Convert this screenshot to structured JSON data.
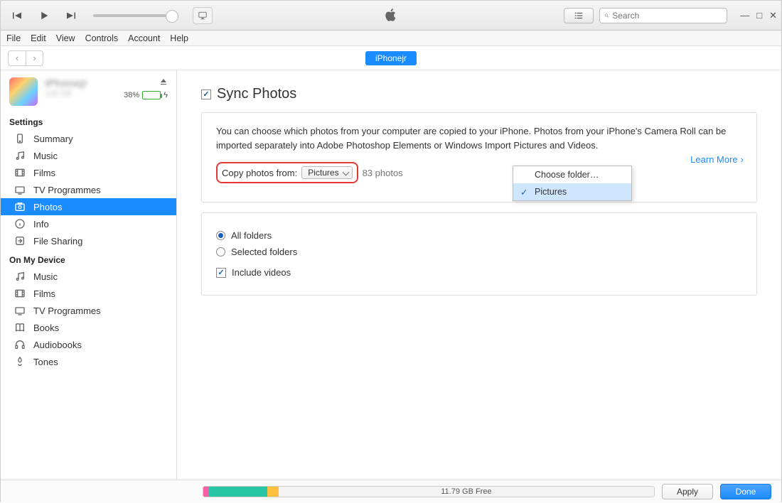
{
  "menubar": [
    "File",
    "Edit",
    "View",
    "Controls",
    "Account",
    "Help"
  ],
  "search_placeholder": "Search",
  "nav": {
    "device_pill": "iPhonejr"
  },
  "device": {
    "name": "iPhonejr",
    "subtitle": "128 GB",
    "battery_pct": "38%"
  },
  "sidebar": {
    "settings_title": "Settings",
    "settings": [
      {
        "icon": "summary",
        "label": "Summary"
      },
      {
        "icon": "music",
        "label": "Music"
      },
      {
        "icon": "films",
        "label": "Films"
      },
      {
        "icon": "tv",
        "label": "TV Programmes"
      },
      {
        "icon": "photos",
        "label": "Photos",
        "selected": true
      },
      {
        "icon": "info",
        "label": "Info"
      },
      {
        "icon": "fileshare",
        "label": "File Sharing"
      }
    ],
    "device_title": "On My Device",
    "device_items": [
      {
        "icon": "music",
        "label": "Music"
      },
      {
        "icon": "films",
        "label": "Films"
      },
      {
        "icon": "tv",
        "label": "TV Programmes"
      },
      {
        "icon": "books",
        "label": "Books"
      },
      {
        "icon": "audiobooks",
        "label": "Audiobooks"
      },
      {
        "icon": "tones",
        "label": "Tones"
      }
    ]
  },
  "content": {
    "title": "Sync Photos",
    "description": "You can choose which photos from your computer are copied to your iPhone. Photos from your iPhone's Camera Roll can be imported separately into Adobe Photoshop Elements or Windows Import Pictures and Videos.",
    "copy_label": "Copy photos from:",
    "dd_value": "Pictures",
    "count": "83 photos",
    "learn_more": "Learn More",
    "dd_menu": [
      "Choose folder…",
      "Pictures"
    ],
    "radio_all": "All folders",
    "radio_selected": "Selected folders",
    "include_videos": "Include videos"
  },
  "footer": {
    "free": "11.79 GB Free",
    "apply": "Apply",
    "done": "Done"
  }
}
